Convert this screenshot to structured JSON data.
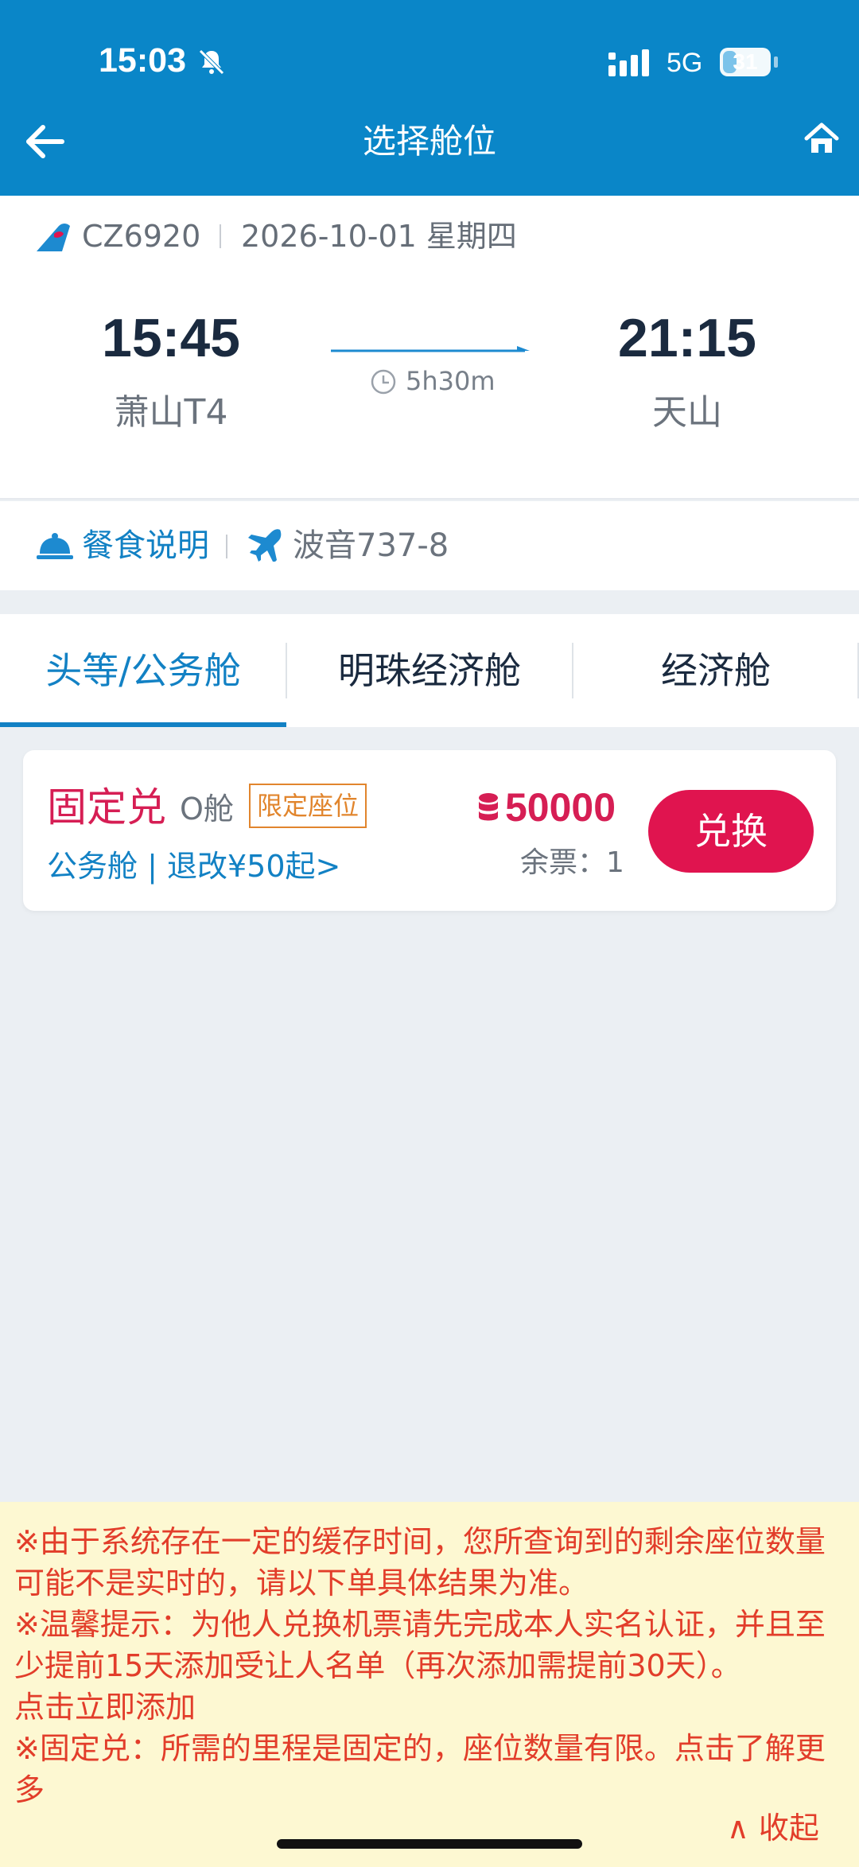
{
  "status_bar": {
    "time": "15:03",
    "network": "5G",
    "battery": "31",
    "battery_level": 0.31
  },
  "header": {
    "title": "选择舱位"
  },
  "flight": {
    "number": "CZ6920",
    "date": "2026-10-01 星期四",
    "departure_time": "15:45",
    "departure_airport": "萧山T4",
    "arrival_time": "21:15",
    "arrival_airport": "天山",
    "duration": "5h30m"
  },
  "info": {
    "meal_label": "餐食说明",
    "aircraft": "波音737-8"
  },
  "tabs": [
    {
      "label": "头等/公务舱",
      "active": true
    },
    {
      "label": "明珠经济舱",
      "active": false
    },
    {
      "label": "经济舱",
      "active": false
    }
  ],
  "fare": {
    "name": "固定兑",
    "cabin_code": "O舱",
    "badge": "限定座位",
    "rule": "公务舱 | 退改¥50起>",
    "miles": "50000",
    "remaining": "余票：1",
    "button": "兑换"
  },
  "notice": {
    "line1": "※由于系统存在一定的缓存时间，您所查询到的剩余座位数量可能不是实时的，请以下单具体结果为准。",
    "line2": "※温馨提示：为他人兑换机票请先完成本人实名认证，并且至少提前15天添加受让人名单（再次添加需提前30天）。",
    "line3": "点击立即添加",
    "line4": "※固定兑：所需的里程是固定的，座位数量有限。点击了解更多",
    "collapse": "∧ 收起"
  },
  "colors": {
    "header": "#0a86c8",
    "accent": "#1281c4",
    "price": "#d61e54",
    "button": "#e0144f",
    "notice_text": "#e23d2a",
    "notice_bg": "#fdf8d2"
  }
}
